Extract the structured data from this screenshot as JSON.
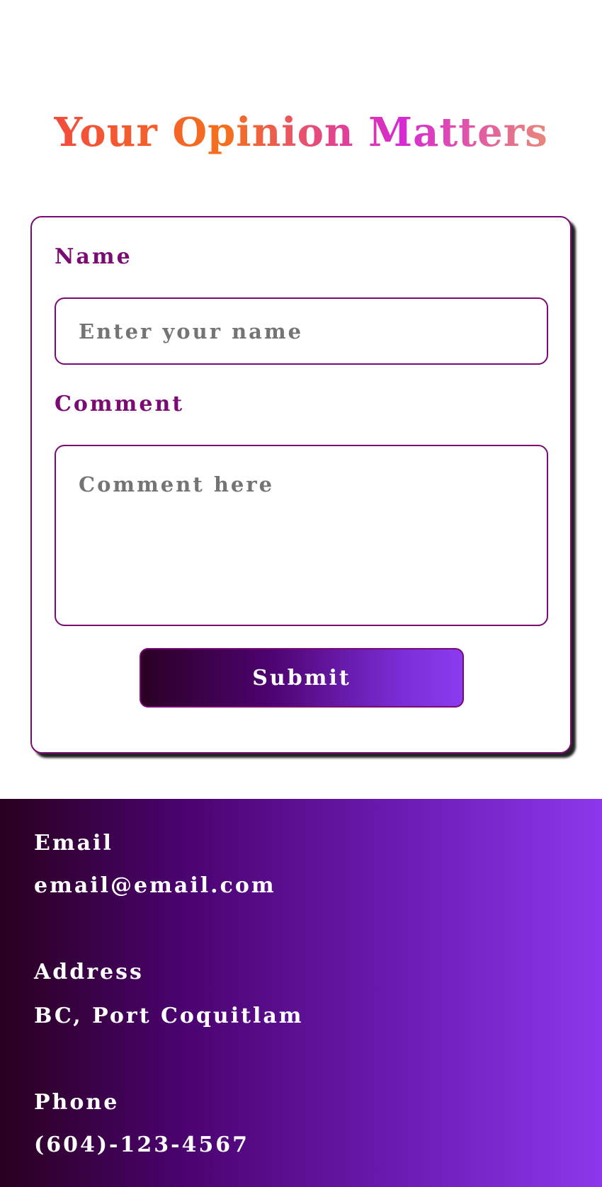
{
  "page": {
    "title": "Your Opinion Matters"
  },
  "form": {
    "name_label": "Name",
    "name_placeholder": "Enter your name",
    "name_value": "",
    "comment_label": "Comment",
    "comment_placeholder": "Comment here",
    "comment_value": "",
    "submit_label": "Submit"
  },
  "footer": {
    "email_label": "Email",
    "email_value": "email@email.com",
    "address_label": "Address",
    "address_value": "BC, Port Coquitlam",
    "phone_label": "Phone",
    "phone_value": "(604)-123-4567"
  },
  "colors": {
    "accent": "#7b0a72",
    "title_gradient": [
      "#f24c3d",
      "#f5701c",
      "#d62ad2",
      "#e98878"
    ],
    "footer_gradient": [
      "#29001f",
      "#4a036e",
      "#6a1ab0",
      "#8b38ec"
    ],
    "placeholder_text": "#747474"
  }
}
